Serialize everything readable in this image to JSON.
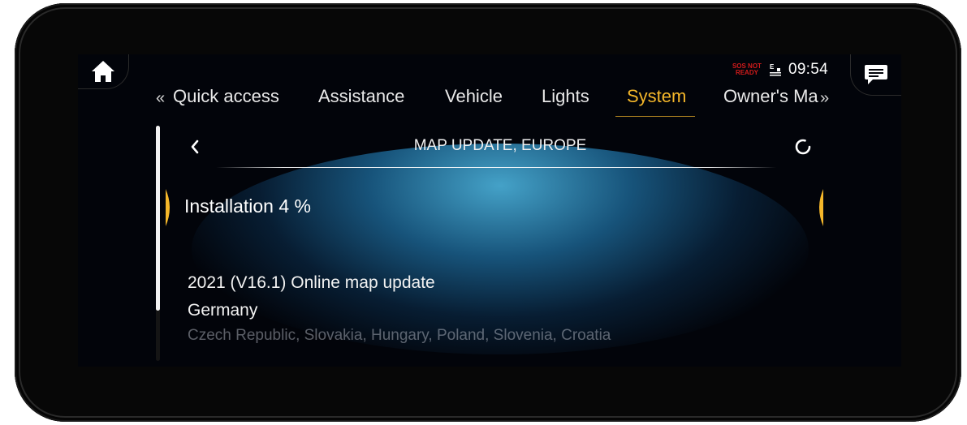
{
  "status": {
    "sos_line1": "SOS NOT",
    "sos_line2": "READY",
    "clock": "09:54"
  },
  "icons": {
    "home": "home-icon",
    "message": "message-icon",
    "back": "chevron-left-icon",
    "loading": "loading-spinner-icon",
    "tabs_prev": "«",
    "tabs_next": "»"
  },
  "tabs": [
    {
      "label": "Quick access",
      "active": false
    },
    {
      "label": "Assistance",
      "active": false
    },
    {
      "label": "Vehicle",
      "active": false
    },
    {
      "label": "Lights",
      "active": false
    },
    {
      "label": "System",
      "active": true
    },
    {
      "label": "Owner's Ma",
      "active": false
    }
  ],
  "page": {
    "title": "MAP UPDATE, EUROPE",
    "installation_label": "Installation 4 %",
    "installation_progress_percent": 4
  },
  "update": {
    "name": "2021 (V16.1) Online map update",
    "region_primary": "Germany",
    "region_secondary": "Czech Republic, Slovakia, Hungary, Poland, Slovenia, Croatia"
  },
  "colors": {
    "accent": "#f5b72a",
    "sos": "#d11b1b",
    "glow": "#48aad2"
  }
}
